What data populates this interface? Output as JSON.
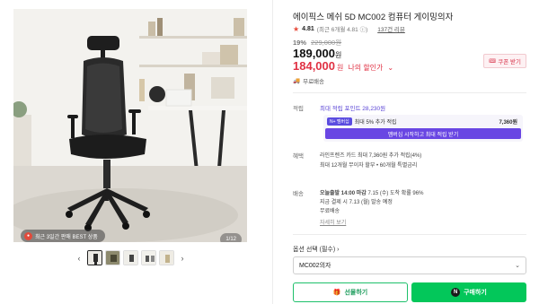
{
  "product": {
    "title": "에이픽스 메쉬 5D MC002 컴퓨터 게이밍의자",
    "rating": "4.81",
    "rating_detail": "(최근 6개월 4.81 ⓘ)",
    "review_link": "137건 리뷰",
    "discount_pct": "19%",
    "original_price": "229,000원",
    "price": "189,000",
    "price_unit": "원",
    "sale_price": "184,000",
    "sale_unit": "원",
    "sale_label": "나의 할인가",
    "coupon_label": "쿠폰 받기",
    "free_shipping": "무료배송"
  },
  "gallery": {
    "badge_text": "최근 3일간 판매 BEST 상품",
    "counter": "1/12",
    "thumbnail_count": 5
  },
  "points": {
    "label": "적립",
    "max_points": "최대 적립 포인트 28,230원",
    "box_tag": "N+ 멤버십",
    "box_text": "최대 5% 추가 적립",
    "box_amount": "7,360원",
    "box_button": "멤버십 시작하고 최대 적립 받기"
  },
  "benefit": {
    "label": "혜택",
    "line1": "라인프렌즈 카드 최대 7,360원 추가 적립(4%)",
    "line2": "최대 12개월 무이자 할부 • 60개월 특별금리"
  },
  "delivery": {
    "label": "배송",
    "line1_prefix": "오늘출발 14:00 마감",
    "line1_rest": "7.15 (수) 도착 확률 96%",
    "line2": "지금 결제 시 7.13 (월) 발송 예정",
    "line3": "무료배송",
    "detail_link": "자세히 보기"
  },
  "option": {
    "label": "옵션 선택 (필수) ›",
    "selected": "MC002의자"
  },
  "buttons": {
    "gift": "선물하기",
    "buy": "구매하기",
    "thumb_prev": "‹",
    "thumb_next": "›"
  },
  "colors": {
    "accent_green": "#03c75a",
    "sale_red": "#e03143",
    "membership_purple": "#6946e3"
  }
}
